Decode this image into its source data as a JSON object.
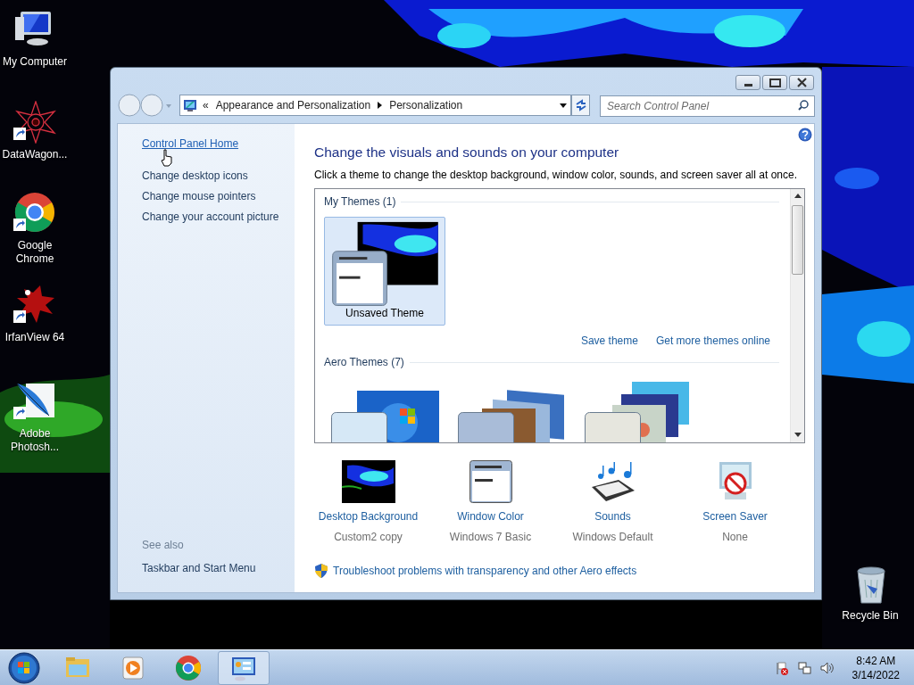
{
  "desktop_icons": [
    {
      "kind": "computer",
      "label": "My Computer",
      "shortcut": false
    },
    {
      "kind": "star",
      "label": "DataWagon...",
      "shortcut": true
    },
    {
      "kind": "chrome",
      "label": "Google Chrome",
      "shortcut": true
    },
    {
      "kind": "splat",
      "label": "IrfanView 64",
      "shortcut": true
    },
    {
      "kind": "feather",
      "label": "Adobe Photosh...",
      "shortcut": true
    },
    {
      "kind": "bin",
      "label": "Recycle Bin",
      "shortcut": false
    }
  ],
  "window": {
    "address": {
      "overflow": "«",
      "crumbs": [
        "Appearance and Personalization",
        "Personalization"
      ]
    },
    "search": {
      "placeholder": "Search Control Panel"
    },
    "sidebar": {
      "links": [
        {
          "label": "Control Panel Home",
          "hovered": true
        },
        {
          "label": "Change desktop icons",
          "hovered": false
        },
        {
          "label": "Change mouse pointers",
          "hovered": false
        },
        {
          "label": "Change your account picture",
          "hovered": false
        }
      ],
      "see_also": {
        "title": "See also",
        "links": [
          "Taskbar and Start Menu"
        ]
      }
    },
    "heading": "Change the visuals and sounds on your computer",
    "description": "Click a theme to change the desktop background, window color, sounds, and screen saver all at once.",
    "theme_sections": [
      {
        "title": "My Themes (1)",
        "themes": [
          {
            "kind": "custom",
            "label": "Unsaved Theme",
            "selected": true
          }
        ],
        "links": [
          "Save theme",
          "Get more themes online"
        ]
      },
      {
        "title": "Aero Themes (7)",
        "themes": [
          {
            "kind": "windows",
            "selected": false
          },
          {
            "kind": "architecture",
            "selected": false
          },
          {
            "kind": "characters",
            "selected": false
          }
        ]
      }
    ],
    "settings": [
      {
        "kind": "background",
        "label": "Desktop Background",
        "value": "Custom2 copy"
      },
      {
        "kind": "color",
        "label": "Window Color",
        "value": "Windows 7 Basic"
      },
      {
        "kind": "sounds",
        "label": "Sounds",
        "value": "Windows Default"
      },
      {
        "kind": "saver",
        "label": "Screen Saver",
        "value": "None"
      }
    ],
    "troubleshoot": "Troubleshoot problems with transparency and other Aero effects"
  },
  "taskbar": {
    "items": [
      {
        "kind": "explorer",
        "active": false
      },
      {
        "kind": "media",
        "active": false
      },
      {
        "kind": "chrome",
        "active": false
      },
      {
        "kind": "control",
        "active": true
      }
    ],
    "time": "8:42 AM",
    "date": "3/14/2022"
  }
}
